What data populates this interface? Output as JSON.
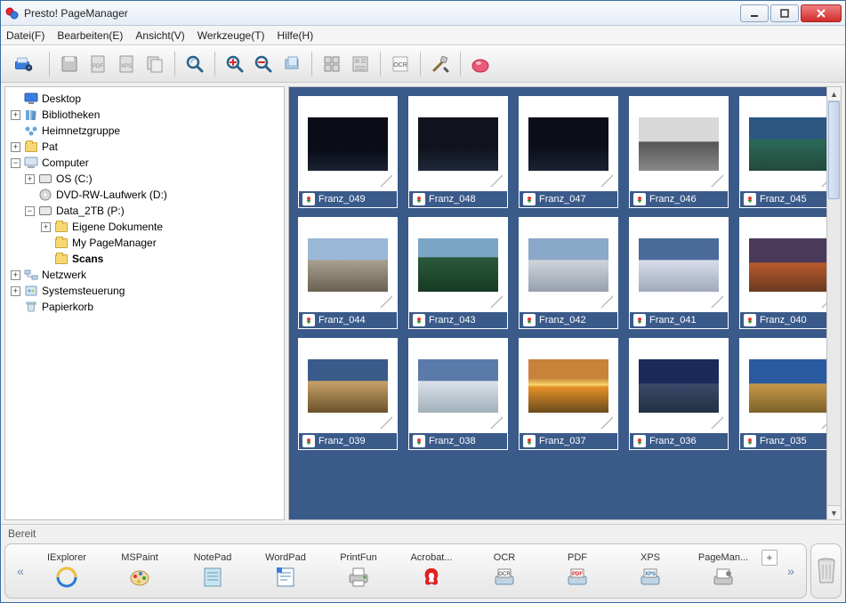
{
  "window": {
    "title": "Presto! PageManager"
  },
  "menu": {
    "file": "Datei(F)",
    "edit": "Bearbeiten(E)",
    "view": "Ansicht(V)",
    "tools": "Werkzeuge(T)",
    "help": "Hilfe(H)"
  },
  "tree": {
    "desktop": "Desktop",
    "bibliotheken": "Bibliotheken",
    "heimnetz": "Heimnetzgruppe",
    "pat": "Pat",
    "computer": "Computer",
    "os_c": "OS (C:)",
    "dvd": "DVD-RW-Laufwerk (D:)",
    "data2tb": "Data_2TB (P:)",
    "eigene": "Eigene Dokumente",
    "mypm": "My PageManager",
    "scans": "Scans",
    "netzwerk": "Netzwerk",
    "system": "Systemsteuerung",
    "papierkorb": "Papierkorb"
  },
  "thumbs": [
    {
      "name": "Franz_049",
      "bg": "linear-gradient(to bottom,#0a0d18 60%,#1a2232)"
    },
    {
      "name": "Franz_048",
      "bg": "linear-gradient(to bottom,#10131e 55%,#1e2838)"
    },
    {
      "name": "Franz_047",
      "bg": "linear-gradient(to bottom,#0c0f1a 55%,#1a2230)"
    },
    {
      "name": "Franz_046",
      "bg": "linear-gradient(to bottom,#d8d8d8 45%,#555 46%,#888)"
    },
    {
      "name": "Franz_045",
      "bg": "linear-gradient(to bottom,#2c5782 40%,#2a6a5a 41%,#244a3a)"
    },
    {
      "name": "Franz_044",
      "bg": "linear-gradient(to bottom,#9ab7d8 40%,#a8a090 41%,#6a6052)"
    },
    {
      "name": "Franz_043",
      "bg": "linear-gradient(to bottom,#7aa6c6 35%,#2a5a3a 36%,#183a24)"
    },
    {
      "name": "Franz_042",
      "bg": "linear-gradient(to bottom,#8aa8c8 40%,#cfd4da 41%,#96a0ac)"
    },
    {
      "name": "Franz_041",
      "bg": "linear-gradient(to bottom,#4a6a9a 40%,#d8ddea 41%,#a0aabc)"
    },
    {
      "name": "Franz_040",
      "bg": "linear-gradient(to bottom,#4a3a5a 45%,#b85a2a 46%,#6a3a22)"
    },
    {
      "name": "Franz_039",
      "bg": "linear-gradient(to bottom,#3a5a8a 40%,#c8a26a 41%,#6a522a)"
    },
    {
      "name": "Franz_038",
      "bg": "linear-gradient(to bottom,#5a7aaa 40%,#dce2ea 41%,#a0b0ba)"
    },
    {
      "name": "Franz_037",
      "bg": "linear-gradient(to bottom,#c8823a 35%,#f7d86a 48%,#e69028 52%,#6a4a1a)"
    },
    {
      "name": "Franz_036",
      "bg": "linear-gradient(to bottom,#1a2a5a 45%,#3a4a6a 46%,#223042)"
    },
    {
      "name": "Franz_035",
      "bg": "linear-gradient(to bottom,#2a5aa0 45%,#c8984a 46%,#7a622a)"
    }
  ],
  "status": {
    "text": "Bereit"
  },
  "launcher": {
    "items": [
      {
        "label": "IExplorer"
      },
      {
        "label": "MSPaint"
      },
      {
        "label": "NotePad"
      },
      {
        "label": "WordPad"
      },
      {
        "label": "PrintFun"
      },
      {
        "label": "Acrobat..."
      },
      {
        "label": "OCR"
      },
      {
        "label": "PDF"
      },
      {
        "label": "XPS"
      },
      {
        "label": "PageMan..."
      }
    ]
  }
}
